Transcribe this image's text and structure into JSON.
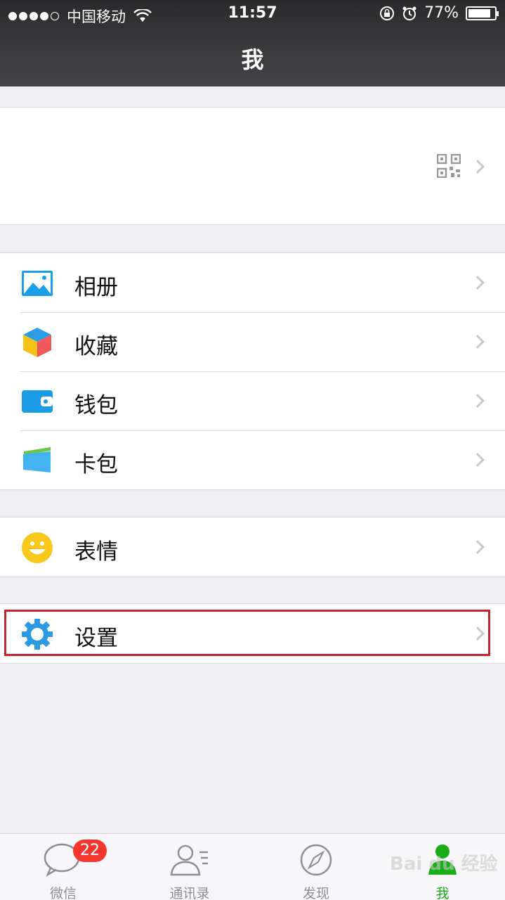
{
  "status": {
    "carrier": "中国移动",
    "time": "11:57",
    "battery": "77%",
    "battery_level": 0.77
  },
  "nav": {
    "title": "我"
  },
  "menu": {
    "group1": [
      {
        "label": "相册",
        "icon": "photo-album-icon"
      },
      {
        "label": "收藏",
        "icon": "favorites-cube-icon"
      },
      {
        "label": "钱包",
        "icon": "wallet-icon"
      },
      {
        "label": "卡包",
        "icon": "card-wallet-icon"
      }
    ],
    "group2": [
      {
        "label": "表情",
        "icon": "smiley-icon"
      }
    ],
    "group3": [
      {
        "label": "设置",
        "icon": "gear-icon"
      }
    ]
  },
  "tabs": [
    {
      "label": "微信",
      "badge": "22",
      "icon": "chat-bubble-icon"
    },
    {
      "label": "通讯录",
      "icon": "contacts-icon"
    },
    {
      "label": "发现",
      "icon": "compass-icon"
    },
    {
      "label": "我",
      "icon": "me-person-icon",
      "active": true
    }
  ],
  "watermark": "Bai du 经验",
  "colors": {
    "accent_green": "#1aad19",
    "highlight_red": "#c4262e",
    "badge_red": "#f43530"
  }
}
